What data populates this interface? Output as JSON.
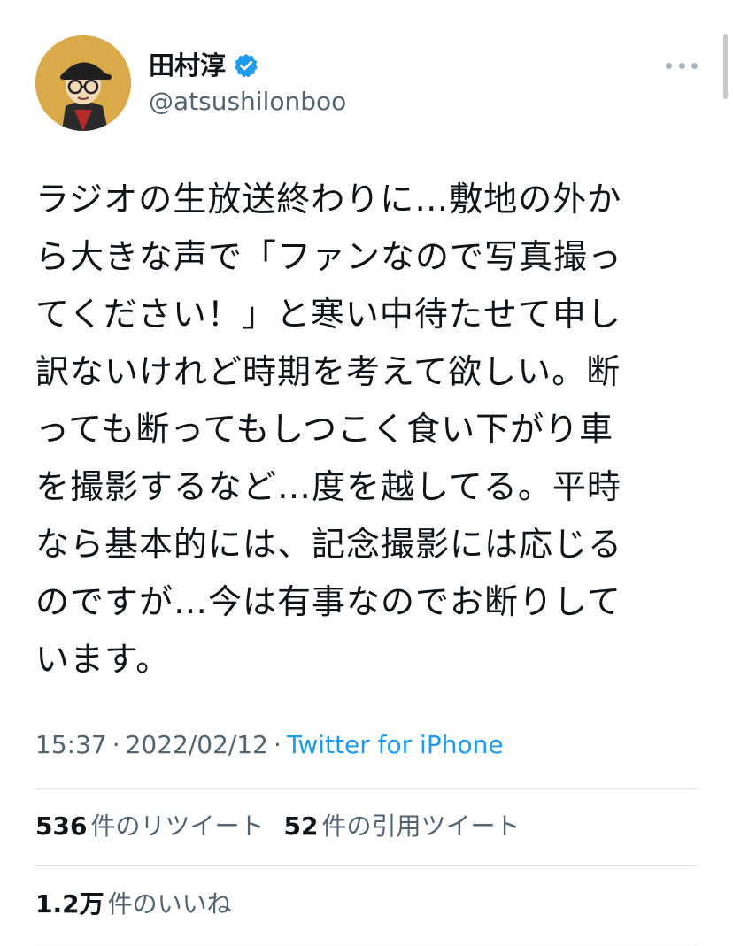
{
  "header": {
    "display_name": "田村淳",
    "handle": "@atsushilonboo",
    "verified_icon": "verified-badge-icon",
    "more_icon": "more-options-icon"
  },
  "tweet": {
    "text": "ラジオの生放送終わりに…敷地の外か\nら大きな声で「ファンなので写真撮っ\nてください！」と寒い中待たせて申し\n訳ないけれど時期を考えて欲しい。断\nっても断ってもしつこく食い下がり車\nを撮影するなど…度を越してる。平時\nなら基本的には、記念撮影には応じる\nのですが…今は有事なのでお断りして\nいます。"
  },
  "meta": {
    "time": "15:37",
    "separator": "·",
    "date": "2022/02/12",
    "source": "Twitter for iPhone"
  },
  "stats": {
    "retweets_count": "536",
    "retweets_label": "件のリツイート",
    "quotes_count": "52",
    "quotes_label": "件の引用ツイート",
    "likes_count": "1.2万",
    "likes_label": "件のいいね"
  },
  "colors": {
    "text": "#0f1419",
    "secondary": "#536471",
    "link": "#1d9bf0",
    "divider": "#dfe4e8",
    "verified": "#1d9bf0"
  }
}
